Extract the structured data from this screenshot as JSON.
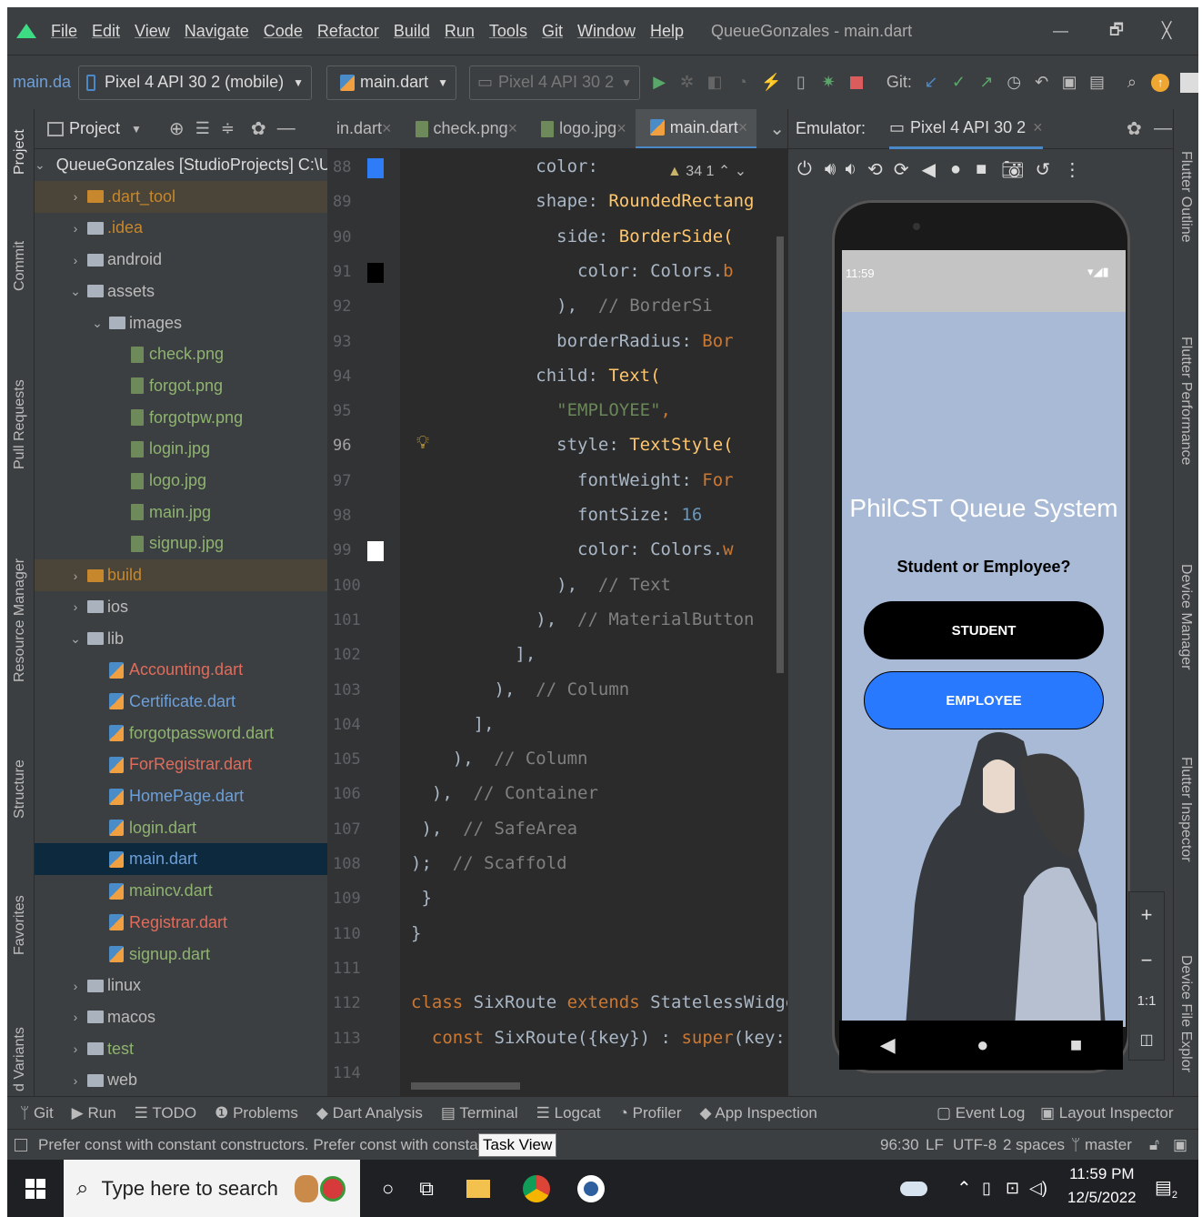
{
  "menu": {
    "items": [
      "File",
      "Edit",
      "View",
      "Navigate",
      "Code",
      "Refactor",
      "Build",
      "Run",
      "Tools",
      "Git",
      "Window",
      "Help"
    ],
    "window_title": "QueueGonzales - main.dart",
    "minimize": "—",
    "restore": "🗗",
    "close": "╳"
  },
  "toolbar": {
    "breadcrumb": "main.da",
    "device_combo": "Pixel 4 API 30 2 (mobile)",
    "run_config": "main.dart",
    "device_combo2": "Pixel 4 API 30 2",
    "git_label": "Git:"
  },
  "left_strip": [
    "Project",
    "Commit",
    "Pull Requests",
    "Resource Manager",
    "Structure",
    "Favorites",
    "d Variants"
  ],
  "right_strip": [
    "Flutter Outline",
    "Flutter Performance",
    "Device Manager",
    "Flutter Inspector",
    "Device File Explor"
  ],
  "project_panel": {
    "title": "Project",
    "tree": [
      {
        "label": "QueueGonzales [StudioProjects] C:\\U",
        "indent": 0,
        "type": "root",
        "arrow": "⌄"
      },
      {
        "label": ".dart_tool",
        "indent": 1,
        "type": "folder-orange",
        "arrow": "›",
        "color": "#c7872c"
      },
      {
        "label": ".idea",
        "indent": 1,
        "type": "folder",
        "arrow": "›",
        "color": "#c7872c"
      },
      {
        "label": "android",
        "indent": 1,
        "type": "folder",
        "arrow": "›",
        "color": "#bbbbbb"
      },
      {
        "label": "assets",
        "indent": 1,
        "type": "folder",
        "arrow": "⌄",
        "color": "#bbbbbb"
      },
      {
        "label": "images",
        "indent": 2,
        "type": "folder",
        "arrow": "⌄",
        "color": "#bbbbbb"
      },
      {
        "label": "check.png",
        "indent": 3,
        "type": "file",
        "arrow": "",
        "color": "#8fb370"
      },
      {
        "label": "forgot.png",
        "indent": 3,
        "type": "file",
        "arrow": "",
        "color": "#8fb370"
      },
      {
        "label": "forgotpw.png",
        "indent": 3,
        "type": "file",
        "arrow": "",
        "color": "#8fb370"
      },
      {
        "label": "login.jpg",
        "indent": 3,
        "type": "file",
        "arrow": "",
        "color": "#8fb370"
      },
      {
        "label": "logo.jpg",
        "indent": 3,
        "type": "file",
        "arrow": "",
        "color": "#8fb370"
      },
      {
        "label": "main.jpg",
        "indent": 3,
        "type": "file",
        "arrow": "",
        "color": "#8fb370"
      },
      {
        "label": "signup.jpg",
        "indent": 3,
        "type": "file",
        "arrow": "",
        "color": "#8fb370"
      },
      {
        "label": "build",
        "indent": 1,
        "type": "folder-orange",
        "arrow": "›",
        "color": "#c7872c"
      },
      {
        "label": "ios",
        "indent": 1,
        "type": "folder",
        "arrow": "›",
        "color": "#bbbbbb"
      },
      {
        "label": "lib",
        "indent": 1,
        "type": "folder",
        "arrow": "⌄",
        "color": "#bbbbbb"
      },
      {
        "label": "Accounting.dart",
        "indent": 2,
        "type": "dart",
        "arrow": "",
        "color": "#e06c5c"
      },
      {
        "label": "Certificate.dart",
        "indent": 2,
        "type": "dart",
        "arrow": "",
        "color": "#6d9fd8"
      },
      {
        "label": "forgotpassword.dart",
        "indent": 2,
        "type": "dart",
        "arrow": "",
        "color": "#8fb370"
      },
      {
        "label": "ForRegistrar.dart",
        "indent": 2,
        "type": "dart",
        "arrow": "",
        "color": "#e06c5c"
      },
      {
        "label": "HomePage.dart",
        "indent": 2,
        "type": "dart",
        "arrow": "",
        "color": "#6d9fd8"
      },
      {
        "label": "login.dart",
        "indent": 2,
        "type": "dart",
        "arrow": "",
        "color": "#8fb370"
      },
      {
        "label": "main.dart",
        "indent": 2,
        "type": "dart",
        "arrow": "",
        "color": "#6d9fd8"
      },
      {
        "label": "maincv.dart",
        "indent": 2,
        "type": "dart",
        "arrow": "",
        "color": "#8fb370"
      },
      {
        "label": "Registrar.dart",
        "indent": 2,
        "type": "dart",
        "arrow": "",
        "color": "#e06c5c"
      },
      {
        "label": "signup.dart",
        "indent": 2,
        "type": "dart",
        "arrow": "",
        "color": "#8fb370"
      },
      {
        "label": "linux",
        "indent": 1,
        "type": "folder",
        "arrow": "›",
        "color": "#bbbbbb"
      },
      {
        "label": "macos",
        "indent": 1,
        "type": "folder",
        "arrow": "›",
        "color": "#bbbbbb"
      },
      {
        "label": "test",
        "indent": 1,
        "type": "folder",
        "arrow": "›",
        "color": "#8fb370"
      },
      {
        "label": "web",
        "indent": 1,
        "type": "folder",
        "arrow": "›",
        "color": "#bbbbbb"
      }
    ]
  },
  "editor": {
    "tabs": [
      {
        "label": "in.dart"
      },
      {
        "label": "check.png"
      },
      {
        "label": "logo.jpg"
      },
      {
        "label": "main.dart"
      }
    ],
    "inspection": "34  1",
    "lines": [
      {
        "num": "88",
        "html": "<span>            color: </span>"
      },
      {
        "num": "89",
        "html": "            shape: <span class='cls'>RoundedRectang</span>"
      },
      {
        "num": "90",
        "html": "              side: <span class='cls'>BorderSide(</span>"
      },
      {
        "num": "91",
        "html": "                color: Colors.<span class='kw'>b</span>"
      },
      {
        "num": "92",
        "html": "              ),  <span class='cm'>// BorderSi</span>"
      },
      {
        "num": "93",
        "html": "              borderRadius: <span class='kw'>Bor</span>"
      },
      {
        "num": "94",
        "html": "            child: <span class='cls'>Text(</span>"
      },
      {
        "num": "95",
        "html": "              <span class='str'>\"EMPLOYEE\"</span><span class='kw'>,</span>"
      },
      {
        "num": "96",
        "html": "              style: <span class='cls'>TextStyle(</span>"
      },
      {
        "num": "97",
        "html": "                fontWeight: <span class='kw'>For</span>"
      },
      {
        "num": "98",
        "html": "                fontSize: <span class='num'>16</span>"
      },
      {
        "num": "99",
        "html": "                color: Colors.<span class='kw'>w</span>"
      },
      {
        "num": "100",
        "html": "              ),  <span class='cm'>// Text</span>"
      },
      {
        "num": "101",
        "html": "            ),  <span class='cm'>// MaterialButton</span>"
      },
      {
        "num": "102",
        "html": "          ],"
      },
      {
        "num": "103",
        "html": "        ),  <span class='cm'>// Column</span>"
      },
      {
        "num": "104",
        "html": "      ],"
      },
      {
        "num": "105",
        "html": "    ),  <span class='cm'>// Column</span>"
      },
      {
        "num": "106",
        "html": "  ),  <span class='cm'>// Container</span>"
      },
      {
        "num": "107",
        "html": " ),  <span class='cm'>// SafeArea</span>"
      },
      {
        "num": "108",
        "html": ");  <span class='cm'>// Scaffold</span>"
      },
      {
        "num": "109",
        "html": " }"
      },
      {
        "num": "110",
        "html": "}"
      },
      {
        "num": "111",
        "html": ""
      },
      {
        "num": "112",
        "html": "<span class='kw'>class</span> SixRoute <span class='kw'>extends</span> StatelessWidget {"
      },
      {
        "num": "113",
        "html": "  <span class='kw'>const</span> SixRoute({key}) : <span class='kw'>super</span>(key: key)"
      },
      {
        "num": "114",
        "html": ""
      }
    ]
  },
  "emulator": {
    "label": "Emulator:",
    "device": "Pixel 4 API 30 2",
    "phone_time": "11:59",
    "app_title": "PhilCST Queue System",
    "question": "Student or Employee?",
    "btn_student": "STUDENT",
    "btn_employee": "EMPLOYEE",
    "zoom_ratio": "1:1",
    "student_color": "#000000",
    "employee_color": "#2979ff"
  },
  "bottom_tools": [
    "Git",
    "Run",
    "TODO",
    "Problems",
    "Dart Analysis",
    "Terminal",
    "Logcat",
    "Profiler",
    "App Inspection"
  ],
  "bottom_tools_right": [
    "Event Log",
    "Layout Inspector"
  ],
  "status": {
    "message": "Prefer const with constant constructors. Prefer const with constant const",
    "tooltip": "Task View",
    "position": "96:30",
    "lf": "LF",
    "encoding": "UTF-8",
    "indent": "2 spaces",
    "branch": "master"
  },
  "taskbar": {
    "search_placeholder": "Type here to search",
    "time": "11:59 PM",
    "date": "12/5/2022",
    "notif_count": "2"
  }
}
